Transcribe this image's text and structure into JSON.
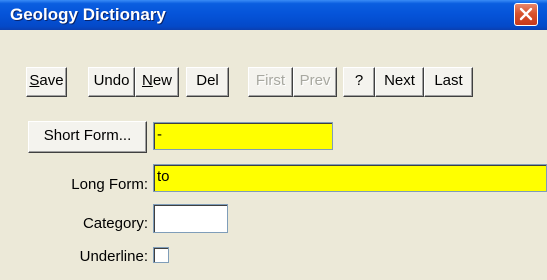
{
  "window": {
    "title": "Geology Dictionary"
  },
  "toolbar": {
    "save_prefix": "S",
    "save_rest": "ave",
    "undo": "Undo",
    "new_prefix": "N",
    "new_rest": "ew",
    "del": "Del",
    "first": "First",
    "prev": "Prev",
    "help": "?",
    "next": "Next",
    "last": "Last"
  },
  "form": {
    "short_form_button": "Short Form...",
    "short_form_value": "-",
    "long_form_label": "Long Form:",
    "long_form_value": "to",
    "category_label": "Category:",
    "category_value": "",
    "underline_label": "Underline:",
    "underline_checked": false
  },
  "colors": {
    "highlight_field": "#ffff00",
    "title_bar": "#0553d8",
    "close_button": "#d8532e"
  }
}
